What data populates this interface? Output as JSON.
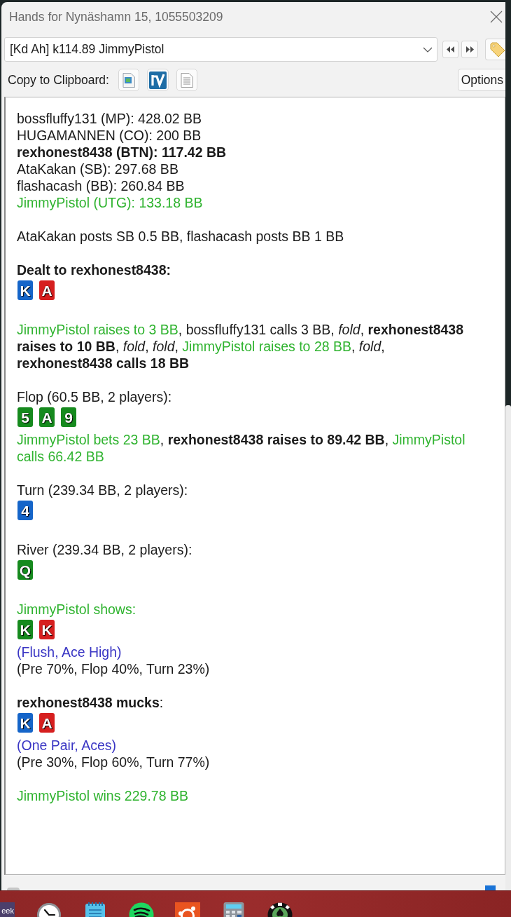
{
  "window": {
    "title": "Hands for Nynäshamn 15, 1055503209"
  },
  "hand_selector": {
    "value": "[Kd Ah] k114.89 JimmyPistol"
  },
  "clipboard_bar": {
    "label": "Copy to Clipboard:",
    "options_button": "Options"
  },
  "history": [
    {
      "lines": [
        {
          "kind": "text",
          "segments": [
            {
              "text": "bossfluffy131 (MP): 428.02 BB",
              "kind": "plain"
            }
          ]
        },
        {
          "kind": "text",
          "segments": [
            {
              "text": "HUGAMANNEN (CO): 200 BB",
              "kind": "plain"
            }
          ]
        },
        {
          "kind": "text",
          "segments": [
            {
              "text": "rexhonest8438 (BTN): 117.42 BB",
              "kind": "bold"
            }
          ]
        },
        {
          "kind": "text",
          "segments": [
            {
              "text": "AtaKakan (SB): 297.68 BB",
              "kind": "plain"
            }
          ]
        },
        {
          "kind": "text",
          "segments": [
            {
              "text": "flashacash (BB): 260.84 BB",
              "kind": "plain"
            }
          ]
        },
        {
          "kind": "text",
          "segments": [
            {
              "text": "JimmyPistol (UTG): 133.18 BB",
              "kind": "hero"
            }
          ]
        }
      ]
    },
    {
      "lines": [
        {
          "kind": "text",
          "segments": [
            {
              "text": "AtaKakan posts SB 0.5 BB, flashacash posts BB 1 BB",
              "kind": "plain"
            }
          ]
        }
      ]
    },
    {
      "lines": [
        {
          "kind": "text",
          "segments": [
            {
              "text": "Dealt to rexhonest8438:",
              "kind": "bold"
            }
          ]
        },
        {
          "kind": "cards",
          "cards": [
            {
              "rank": "K",
              "color": "#1565c9"
            },
            {
              "rank": "A",
              "color": "#d61f1f"
            }
          ]
        }
      ]
    },
    {
      "lines": [
        {
          "kind": "text",
          "segments": [
            {
              "text": "JimmyPistol raises to 3 BB",
              "kind": "hero"
            },
            {
              "text": ", bossfluffy131 calls 3 BB, ",
              "kind": "plain"
            },
            {
              "text": "fold",
              "kind": "italic"
            },
            {
              "text": ", ",
              "kind": "plain"
            },
            {
              "text": "rexhonest8438 raises to 10 BB",
              "kind": "bold"
            },
            {
              "text": ", ",
              "kind": "plain"
            },
            {
              "text": "fold",
              "kind": "italic"
            },
            {
              "text": ", ",
              "kind": "plain"
            },
            {
              "text": "fold",
              "kind": "italic"
            },
            {
              "text": ", ",
              "kind": "plain"
            },
            {
              "text": "JimmyPistol raises to 28 BB",
              "kind": "hero"
            },
            {
              "text": ", ",
              "kind": "plain"
            },
            {
              "text": "fold",
              "kind": "italic"
            },
            {
              "text": ", ",
              "kind": "plain"
            },
            {
              "text": "rexhonest8438 calls 18 BB",
              "kind": "bold"
            }
          ]
        }
      ]
    },
    {
      "lines": [
        {
          "kind": "text",
          "segments": [
            {
              "text": "Flop (60.5 BB, 2 players):",
              "kind": "plain"
            }
          ]
        },
        {
          "kind": "cards",
          "cards": [
            {
              "rank": "5",
              "color": "#168a1e"
            },
            {
              "rank": "A",
              "color": "#168a1e"
            },
            {
              "rank": "9",
              "color": "#168a1e"
            }
          ]
        },
        {
          "kind": "text",
          "segments": [
            {
              "text": "JimmyPistol bets 23 BB",
              "kind": "hero"
            },
            {
              "text": ", ",
              "kind": "plain"
            },
            {
              "text": "rexhonest8438 raises to 89.42 BB",
              "kind": "bold"
            },
            {
              "text": ", ",
              "kind": "plain"
            },
            {
              "text": "JimmyPistol calls 66.42 BB",
              "kind": "hero"
            }
          ]
        }
      ]
    },
    {
      "lines": [
        {
          "kind": "text",
          "segments": [
            {
              "text": "Turn (239.34 BB, 2 players):",
              "kind": "plain"
            }
          ]
        },
        {
          "kind": "cards",
          "cards": [
            {
              "rank": "4",
              "color": "#1565c9"
            }
          ]
        }
      ]
    },
    {
      "lines": [
        {
          "kind": "text",
          "segments": [
            {
              "text": "River (239.34 BB, 2 players):",
              "kind": "plain"
            }
          ]
        },
        {
          "kind": "cards",
          "cards": [
            {
              "rank": "Q",
              "color": "#168a1e"
            }
          ]
        }
      ]
    },
    {
      "lines": [
        {
          "kind": "text",
          "segments": [
            {
              "text": "JimmyPistol shows:",
              "kind": "hero"
            }
          ]
        },
        {
          "kind": "cards",
          "cards": [
            {
              "rank": "K",
              "color": "#168a1e"
            },
            {
              "rank": "K",
              "color": "#d61f1f"
            }
          ]
        },
        {
          "kind": "text",
          "segments": [
            {
              "text": "(Flush, Ace High)",
              "kind": "hand"
            }
          ]
        },
        {
          "kind": "text",
          "segments": [
            {
              "text": "(Pre 70%, Flop 40%, Turn 23%)",
              "kind": "plain"
            }
          ]
        }
      ]
    },
    {
      "lines": [
        {
          "kind": "text",
          "segments": [
            {
              "text": "rexhonest8438 mucks",
              "kind": "bold"
            },
            {
              "text": ":",
              "kind": "plain"
            }
          ]
        },
        {
          "kind": "cards",
          "cards": [
            {
              "rank": "K",
              "color": "#1565c9"
            },
            {
              "rank": "A",
              "color": "#d61f1f"
            }
          ]
        },
        {
          "kind": "text",
          "segments": [
            {
              "text": "(One Pair, Aces)",
              "kind": "hand"
            }
          ]
        },
        {
          "kind": "text",
          "segments": [
            {
              "text": "(Pre 30%, Flop 60%, Turn 77%)",
              "kind": "plain"
            }
          ]
        }
      ]
    },
    {
      "lines": [
        {
          "kind": "text",
          "segments": [
            {
              "text": "JimmyPistol wins 229.78 BB",
              "kind": "hero"
            }
          ]
        }
      ]
    }
  ],
  "taskbar": [
    {
      "kind": "tile",
      "label": "eek"
    },
    {
      "kind": "clock"
    },
    {
      "kind": "notepad"
    },
    {
      "kind": "waves"
    },
    {
      "kind": "ring"
    },
    {
      "kind": "calculator"
    },
    {
      "kind": "chip"
    }
  ]
}
